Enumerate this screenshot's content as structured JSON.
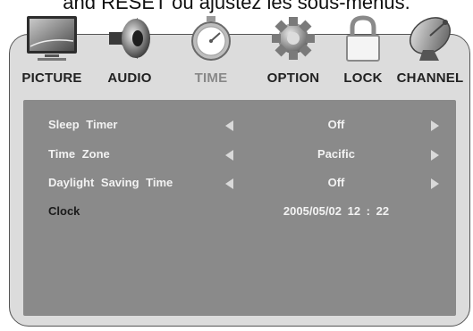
{
  "caption": "and RESET ou ajustez les sous-menus.",
  "tabs": [
    {
      "label": "PICTURE",
      "icon": "picture-icon"
    },
    {
      "label": "AUDIO",
      "icon": "speaker-icon"
    },
    {
      "label": "TIME",
      "icon": "stopwatch-icon",
      "active": true
    },
    {
      "label": "OPTION",
      "icon": "gear-icon"
    },
    {
      "label": "LOCK",
      "icon": "lock-icon"
    },
    {
      "label": "CHANNEL",
      "icon": "satellite-dish-icon"
    }
  ],
  "rows": [
    {
      "name": "Sleep Timer",
      "value": "Off",
      "has_arrows": true
    },
    {
      "name": "Time Zone",
      "value": "Pacific",
      "has_arrows": true
    },
    {
      "name": "Daylight Saving Time",
      "value": "Off",
      "has_arrows": true
    },
    {
      "name": "Clock",
      "value": "2005/05/02  12 : 22",
      "has_arrows": false
    }
  ],
  "colors": {
    "panel": "#8a8a8a",
    "frame": "#dcdcdc",
    "active_tab_label": "#888888",
    "text_light": "#f2f2f2"
  }
}
